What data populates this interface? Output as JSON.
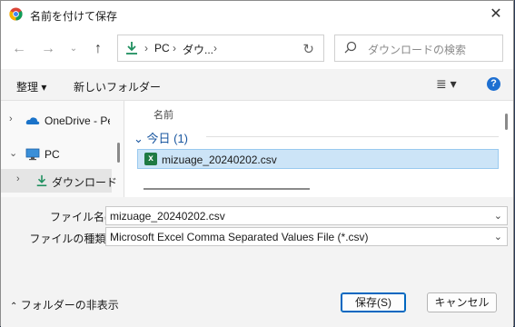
{
  "window": {
    "title": "名前を付けて保存"
  },
  "nav": {
    "breadcrumb": [
      "PC",
      "ダウ..."
    ],
    "search_placeholder": "ダウンロードの検索"
  },
  "toolbar": {
    "organize": "整理 ▾",
    "new_folder": "新しいフォルダー"
  },
  "sidebar": {
    "items": [
      {
        "label": "OneDrive - Personal",
        "expanded": false
      },
      {
        "label": "PC",
        "expanded": true
      },
      {
        "label": "ダウンロード",
        "expanded": false,
        "selected": true
      }
    ]
  },
  "files": {
    "column_name": "名前",
    "group": "今日 (1)",
    "items": [
      {
        "name": "mizuage_20240202.csv",
        "icon": "excel-csv-icon"
      }
    ]
  },
  "form": {
    "filename_label": "ファイル名(N):",
    "filename_value": "mizuage_20240202.csv",
    "type_label": "ファイルの種類(T):",
    "type_value": "Microsoft Excel Comma Separated Values File (*.csv)"
  },
  "footer": {
    "hide_folders": "フォルダーの非表示",
    "save": "保存(S)",
    "cancel": "キャンセル"
  },
  "colors": {
    "accent": "#0067c0",
    "selection": "#cce4f7",
    "help": "#1e6fd1"
  }
}
